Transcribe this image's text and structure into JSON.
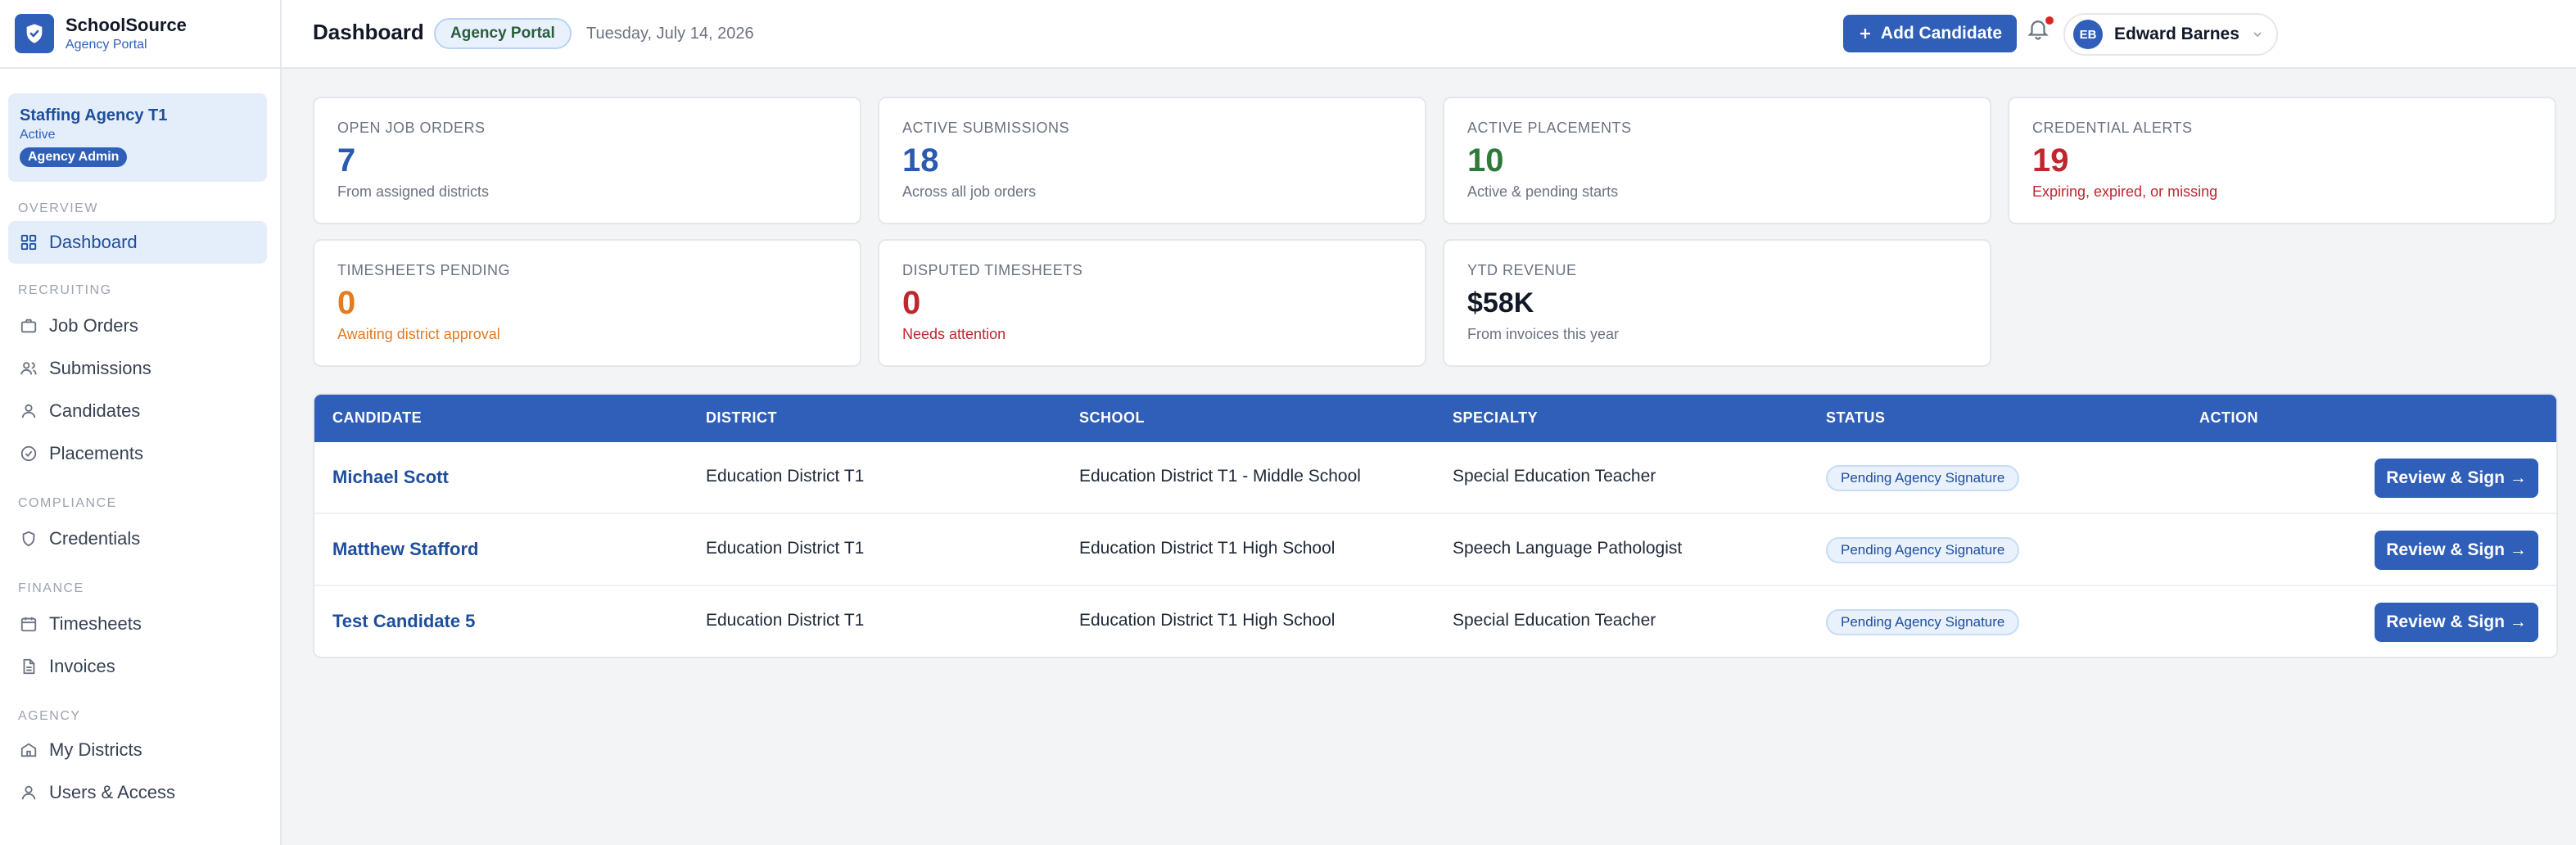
{
  "brand": {
    "name": "SchoolSource",
    "subtitle": "Agency Portal"
  },
  "agency": {
    "name": "Staffing Agency T1",
    "status": "Active",
    "role": "Agency Admin"
  },
  "nav": {
    "sections": {
      "overview": "OVERVIEW",
      "recruiting": "RECRUITING",
      "compliance": "COMPLIANCE",
      "finance": "FINANCE",
      "agency": "AGENCY"
    },
    "items": {
      "dashboard": "Dashboard",
      "job_orders": "Job Orders",
      "submissions": "Submissions",
      "candidates": "Candidates",
      "placements": "Placements",
      "credentials": "Credentials",
      "timesheets": "Timesheets",
      "invoices": "Invoices",
      "my_districts": "My Districts",
      "users_access": "Users & Access"
    }
  },
  "header": {
    "title": "Dashboard",
    "portal_badge": "Agency Portal",
    "date": "Tuesday, July 14, 2026",
    "add_button": "Add Candidate",
    "user_initials": "EB",
    "user_name": "Edward Barnes"
  },
  "stats": {
    "open_job_orders": {
      "label": "OPEN JOB ORDERS",
      "value": "7",
      "note": "From assigned districts"
    },
    "active_submissions": {
      "label": "ACTIVE SUBMISSIONS",
      "value": "18",
      "note": "Across all job orders"
    },
    "active_placements": {
      "label": "ACTIVE PLACEMENTS",
      "value": "10",
      "note": "Active & pending starts"
    },
    "credential_alerts": {
      "label": "CREDENTIAL ALERTS",
      "value": "19",
      "note": "Expiring, expired, or missing"
    },
    "timesheets_pending": {
      "label": "TIMESHEETS PENDING",
      "value": "0",
      "note": "Awaiting district approval"
    },
    "disputed_timesheets": {
      "label": "DISPUTED TIMESHEETS",
      "value": "0",
      "note": "Needs attention"
    },
    "ytd_revenue": {
      "label": "YTD REVENUE",
      "value": "$58K",
      "note": "From invoices this year"
    }
  },
  "table": {
    "headers": {
      "candidate": "CANDIDATE",
      "district": "DISTRICT",
      "school": "SCHOOL",
      "specialty": "SPECIALTY",
      "status": "STATUS",
      "action": "ACTION"
    },
    "rows": [
      {
        "candidate": "Michael Scott",
        "district": "Education District T1",
        "school": "Education District T1 - Middle School",
        "specialty": "Special Education Teacher",
        "status": "Pending Agency Signature",
        "action": "Review & Sign →"
      },
      {
        "candidate": "Matthew Stafford",
        "district": "Education District T1",
        "school": "Education District T1 High School",
        "specialty": "Speech Language Pathologist",
        "status": "Pending Agency Signature",
        "action": "Review & Sign →"
      },
      {
        "candidate": "Test Candidate 5",
        "district": "Education District T1",
        "school": "Education District T1 High School",
        "specialty": "Special Education Teacher",
        "status": "Pending Agency Signature",
        "action": "Review & Sign →"
      }
    ]
  },
  "colors": {
    "primary": "#2f5fb8",
    "blue_value": "#2a5ab0",
    "green_value": "#2f7a3a",
    "red_value": "#c0262d",
    "orange_value": "#e57a1f"
  }
}
